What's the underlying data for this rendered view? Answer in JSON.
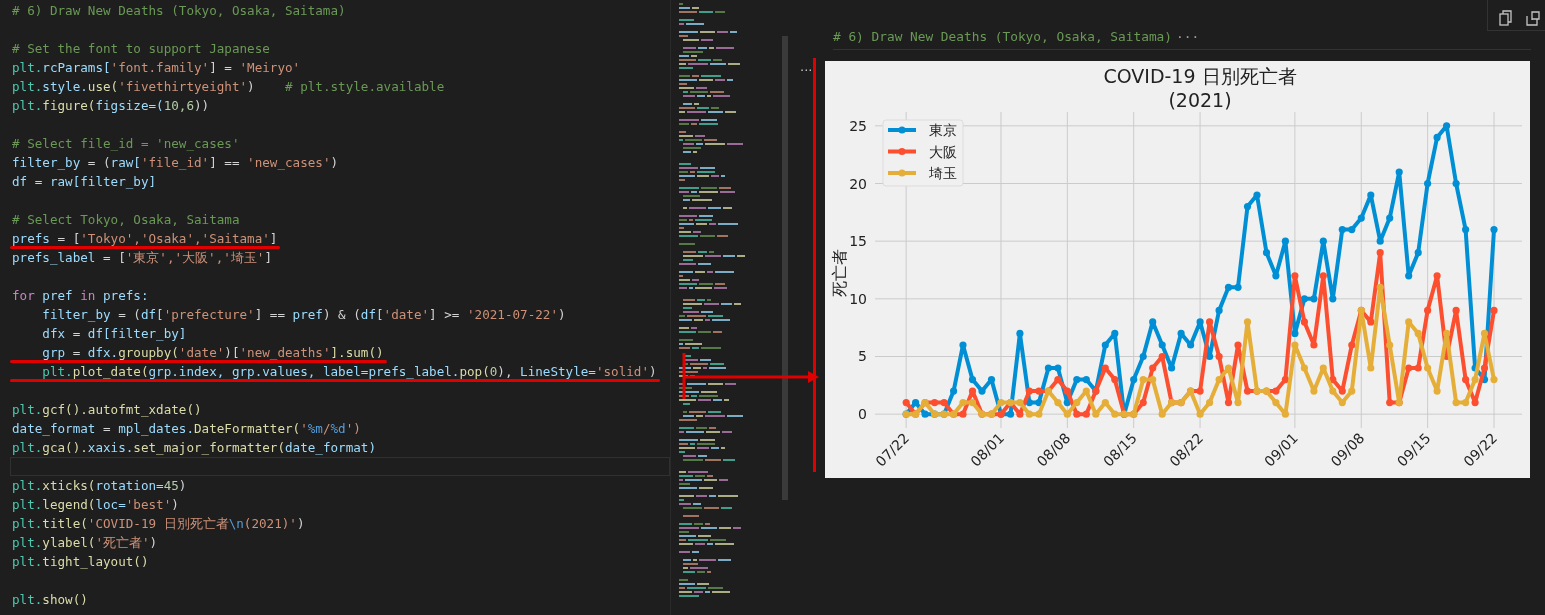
{
  "editor": {
    "lines": [
      {
        "kind": "code",
        "tokens": [
          {
            "kind": "cm",
            "text": "# 6) Draw New Deaths (Tokyo, Osaka, Saitama)"
          }
        ]
      },
      {
        "kind": "blank"
      },
      {
        "kind": "code",
        "tokens": [
          {
            "kind": "cm",
            "text": "# Set the font to support Japanese"
          }
        ]
      },
      {
        "kind": "code",
        "tokens": [
          {
            "kind": "mod",
            "text": "plt."
          },
          {
            "kind": "id",
            "text": "rcParams["
          },
          {
            "kind": "st",
            "text": "'font.family'"
          },
          {
            "kind": "op",
            "text": "] = "
          },
          {
            "kind": "st",
            "text": "'Meiryo'"
          }
        ]
      },
      {
        "kind": "code",
        "tokens": [
          {
            "kind": "mod",
            "text": "plt."
          },
          {
            "kind": "id",
            "text": "style."
          },
          {
            "kind": "fn",
            "text": "use("
          },
          {
            "kind": "st",
            "text": "'fivethirtyeight'"
          },
          {
            "kind": "op",
            "text": ")    "
          },
          {
            "kind": "cm",
            "text": "# plt.style.available"
          }
        ]
      },
      {
        "kind": "code",
        "tokens": [
          {
            "kind": "mod",
            "text": "plt."
          },
          {
            "kind": "fn",
            "text": "figure("
          },
          {
            "kind": "id",
            "text": "figsize=("
          },
          {
            "kind": "num",
            "text": "10,6"
          },
          {
            "kind": "op",
            "text": "))"
          }
        ]
      },
      {
        "kind": "blank"
      },
      {
        "kind": "code",
        "tokens": [
          {
            "kind": "cm",
            "text": "# Select file_id = 'new_cases'"
          }
        ]
      },
      {
        "kind": "code",
        "tokens": [
          {
            "kind": "id",
            "text": "filter_by"
          },
          {
            "kind": "op",
            "text": " = ("
          },
          {
            "kind": "id",
            "text": "raw["
          },
          {
            "kind": "st",
            "text": "'file_id'"
          },
          {
            "kind": "op",
            "text": "] == "
          },
          {
            "kind": "st",
            "text": "'new_cases'"
          },
          {
            "kind": "op",
            "text": ")"
          }
        ]
      },
      {
        "kind": "code",
        "tokens": [
          {
            "kind": "id",
            "text": "df"
          },
          {
            "kind": "op",
            "text": " = "
          },
          {
            "kind": "id",
            "text": "raw[filter_by]"
          }
        ]
      },
      {
        "kind": "blank"
      },
      {
        "kind": "code",
        "tokens": [
          {
            "kind": "cm",
            "text": "# Select Tokyo, Osaka, Saitama"
          }
        ]
      },
      {
        "kind": "code",
        "underlined": true,
        "tokens": [
          {
            "kind": "id",
            "text": "prefs"
          },
          {
            "kind": "op",
            "text": " = ["
          },
          {
            "kind": "st",
            "text": "'Tokyo',"
          },
          {
            "kind": "st",
            "text": "'Osaka',"
          },
          {
            "kind": "st",
            "text": "'Saitama'"
          },
          {
            "kind": "op",
            "text": "]"
          }
        ]
      },
      {
        "kind": "code",
        "tokens": [
          {
            "kind": "id",
            "text": "prefs_label"
          },
          {
            "kind": "op",
            "text": " = ["
          },
          {
            "kind": "st",
            "text": "'東京',"
          },
          {
            "kind": "st",
            "text": "'大阪',"
          },
          {
            "kind": "st",
            "text": "'埼玉'"
          },
          {
            "kind": "op",
            "text": "]"
          }
        ]
      },
      {
        "kind": "blank"
      },
      {
        "kind": "code",
        "tokens": [
          {
            "kind": "kw",
            "text": "for"
          },
          {
            "kind": "id",
            "text": " pref "
          },
          {
            "kind": "kw",
            "text": "in"
          },
          {
            "kind": "id",
            "text": " prefs:"
          }
        ]
      },
      {
        "kind": "code",
        "tokens": [
          {
            "kind": "id",
            "text": "    filter_by"
          },
          {
            "kind": "op",
            "text": " = ("
          },
          {
            "kind": "id",
            "text": "df["
          },
          {
            "kind": "st",
            "text": "'prefecture'"
          },
          {
            "kind": "op",
            "text": "] == "
          },
          {
            "kind": "id",
            "text": "pref"
          },
          {
            "kind": "op",
            "text": ") & ("
          },
          {
            "kind": "id",
            "text": "df["
          },
          {
            "kind": "st",
            "text": "'date'"
          },
          {
            "kind": "op",
            "text": "] >= "
          },
          {
            "kind": "st",
            "text": "'2021-07-22'"
          },
          {
            "kind": "op",
            "text": ")"
          }
        ]
      },
      {
        "kind": "code",
        "tokens": [
          {
            "kind": "id",
            "text": "    dfx"
          },
          {
            "kind": "op",
            "text": " = "
          },
          {
            "kind": "id",
            "text": "df[filter_by]"
          }
        ]
      },
      {
        "kind": "code",
        "underlined": true,
        "tokens": [
          {
            "kind": "id",
            "text": "    grp"
          },
          {
            "kind": "op",
            "text": " = "
          },
          {
            "kind": "id",
            "text": "dfx."
          },
          {
            "kind": "fn",
            "text": "groupby("
          },
          {
            "kind": "st",
            "text": "'date'"
          },
          {
            "kind": "op",
            "text": ")["
          },
          {
            "kind": "st",
            "text": "'new_deaths'"
          },
          {
            "kind": "fn",
            "text": "].sum()"
          }
        ]
      },
      {
        "kind": "code",
        "underlined": true,
        "tokens": [
          {
            "kind": "mod",
            "text": "    plt."
          },
          {
            "kind": "fn",
            "text": "plot_date("
          },
          {
            "kind": "id",
            "text": "grp.index, "
          },
          {
            "kind": "id",
            "text": "grp.values, "
          },
          {
            "kind": "id",
            "text": "label=prefs_label."
          },
          {
            "kind": "fn",
            "text": "pop("
          },
          {
            "kind": "num",
            "text": "0"
          },
          {
            "kind": "op",
            "text": "), "
          },
          {
            "kind": "id",
            "text": "LineStyle="
          },
          {
            "kind": "st",
            "text": "'solid'"
          },
          {
            "kind": "op",
            "text": ")"
          }
        ]
      },
      {
        "kind": "blank"
      },
      {
        "kind": "code",
        "tokens": [
          {
            "kind": "mod",
            "text": "plt."
          },
          {
            "kind": "fn",
            "text": "gcf()."
          },
          {
            "kind": "fn",
            "text": "autofmt_xdate()"
          }
        ]
      },
      {
        "kind": "code",
        "tokens": [
          {
            "kind": "id",
            "text": "date_format"
          },
          {
            "kind": "op",
            "text": " = "
          },
          {
            "kind": "id",
            "text": "mpl_dates."
          },
          {
            "kind": "fn",
            "text": "DateFormatter("
          },
          {
            "kind": "st",
            "text": "'"
          },
          {
            "kind": "esc",
            "text": "%m"
          },
          {
            "kind": "st",
            "text": "/"
          },
          {
            "kind": "esc",
            "text": "%d"
          },
          {
            "kind": "st",
            "text": "')"
          }
        ]
      },
      {
        "kind": "code",
        "tokens": [
          {
            "kind": "mod",
            "text": "plt."
          },
          {
            "kind": "fn",
            "text": "gca()."
          },
          {
            "kind": "id",
            "text": "xaxis."
          },
          {
            "kind": "fn",
            "text": "set_major_formatter("
          },
          {
            "kind": "id",
            "text": "date_format)"
          }
        ]
      },
      {
        "kind": "blank",
        "current": true
      },
      {
        "kind": "code",
        "tokens": [
          {
            "kind": "mod",
            "text": "plt."
          },
          {
            "kind": "fn",
            "text": "xticks("
          },
          {
            "kind": "id",
            "text": "rotation="
          },
          {
            "kind": "num",
            "text": "45"
          },
          {
            "kind": "op",
            "text": ")"
          }
        ]
      },
      {
        "kind": "code",
        "tokens": [
          {
            "kind": "mod",
            "text": "plt."
          },
          {
            "kind": "fn",
            "text": "legend("
          },
          {
            "kind": "id",
            "text": "loc="
          },
          {
            "kind": "st",
            "text": "'best'"
          },
          {
            "kind": "op",
            "text": ")"
          }
        ]
      },
      {
        "kind": "code",
        "tokens": [
          {
            "kind": "mod",
            "text": "plt."
          },
          {
            "kind": "fn",
            "text": "title("
          },
          {
            "kind": "st",
            "text": "'COVID-19 日別死亡者"
          },
          {
            "kind": "esc",
            "text": "\\n"
          },
          {
            "kind": "st",
            "text": "(2021)'"
          },
          {
            "kind": "op",
            "text": ")"
          }
        ]
      },
      {
        "kind": "code",
        "tokens": [
          {
            "kind": "mod",
            "text": "plt."
          },
          {
            "kind": "fn",
            "text": "ylabel("
          },
          {
            "kind": "st",
            "text": "'死亡者'"
          },
          {
            "kind": "op",
            "text": ")"
          }
        ]
      },
      {
        "kind": "code",
        "tokens": [
          {
            "kind": "mod",
            "text": "plt."
          },
          {
            "kind": "fn",
            "text": "tight_layout()"
          }
        ]
      },
      {
        "kind": "blank"
      },
      {
        "kind": "code",
        "tokens": [
          {
            "kind": "mod",
            "text": "plt."
          },
          {
            "kind": "fn",
            "text": "show()"
          }
        ]
      }
    ]
  },
  "output": {
    "cell_title": "# 6) Draw New Deaths (Tokyo, Osaka, Saitama)",
    "cell_title_more": "···",
    "output_more": "···",
    "chart_data": {
      "type": "line",
      "title": "COVID-19 日別死亡者\n(2021)",
      "ylabel": "死亡者",
      "categories": [
        "07/22",
        null,
        null,
        null,
        null,
        null,
        null,
        null,
        null,
        null,
        "08/01",
        null,
        null,
        null,
        null,
        null,
        null,
        "08/08",
        null,
        null,
        null,
        null,
        null,
        null,
        "08/15",
        null,
        null,
        null,
        null,
        null,
        null,
        "08/22",
        null,
        null,
        null,
        null,
        null,
        null,
        null,
        null,
        null,
        "09/01",
        null,
        null,
        null,
        null,
        null,
        null,
        "09/08",
        null,
        null,
        null,
        null,
        null,
        null,
        "09/15",
        null,
        null,
        null,
        null,
        null,
        null,
        "09/22"
      ],
      "series": [
        {
          "name": "東京",
          "color": "#008fd5",
          "marker": "o",
          "values": [
            0,
            1,
            0,
            0,
            0,
            2,
            6,
            3,
            2,
            3,
            0,
            0,
            7,
            1,
            1,
            4,
            4,
            1,
            3,
            3,
            2,
            6,
            7,
            0,
            3,
            5,
            8,
            6,
            4,
            7,
            6,
            8,
            5,
            9,
            11,
            11,
            18,
            19,
            14,
            12,
            15,
            7,
            10,
            10,
            15,
            10,
            16,
            16,
            17,
            19,
            15,
            17,
            21,
            12,
            14,
            20,
            24,
            25,
            20,
            16,
            4,
            3,
            16
          ]
        },
        {
          "name": "大阪",
          "color": "#fc4f30",
          "marker": "o",
          "values": [
            1,
            0,
            1,
            1,
            1,
            0,
            0,
            2,
            0,
            0,
            0,
            1,
            0,
            2,
            2,
            2,
            3,
            2,
            0,
            0,
            2,
            4,
            3,
            0,
            0,
            1,
            4,
            5,
            1,
            1,
            2,
            2,
            8,
            5,
            1,
            6,
            2,
            2,
            2,
            2,
            3,
            12,
            8,
            6,
            12,
            3,
            2,
            6,
            9,
            8,
            14,
            1,
            1,
            4,
            4,
            9,
            12,
            5,
            9,
            3,
            1,
            4,
            9
          ]
        },
        {
          "name": "埼玉",
          "color": "#e5ae38",
          "marker": "o",
          "values": [
            0,
            0,
            1,
            0,
            0,
            0,
            1,
            1,
            0,
            0,
            1,
            1,
            1,
            0,
            0,
            2,
            1,
            0,
            1,
            2,
            0,
            1,
            0,
            0,
            0,
            3,
            3,
            0,
            1,
            1,
            2,
            0,
            1,
            3,
            4,
            1,
            8,
            2,
            2,
            1,
            0,
            6,
            4,
            2,
            4,
            2,
            1,
            2,
            9,
            4,
            11,
            6,
            1,
            8,
            7,
            4,
            2,
            7,
            1,
            1,
            3,
            7,
            3
          ]
        }
      ],
      "grid": true,
      "legend": true,
      "ylim": [
        -1.2,
        26.2
      ],
      "yticks": [
        {
          "value": 0,
          "label": "0"
        },
        {
          "value": 5,
          "label": "5"
        },
        {
          "value": 10,
          "label": "10"
        },
        {
          "value": 15,
          "label": "15"
        },
        {
          "value": 20,
          "label": "20"
        },
        {
          "value": 25,
          "label": "25"
        }
      ]
    }
  }
}
